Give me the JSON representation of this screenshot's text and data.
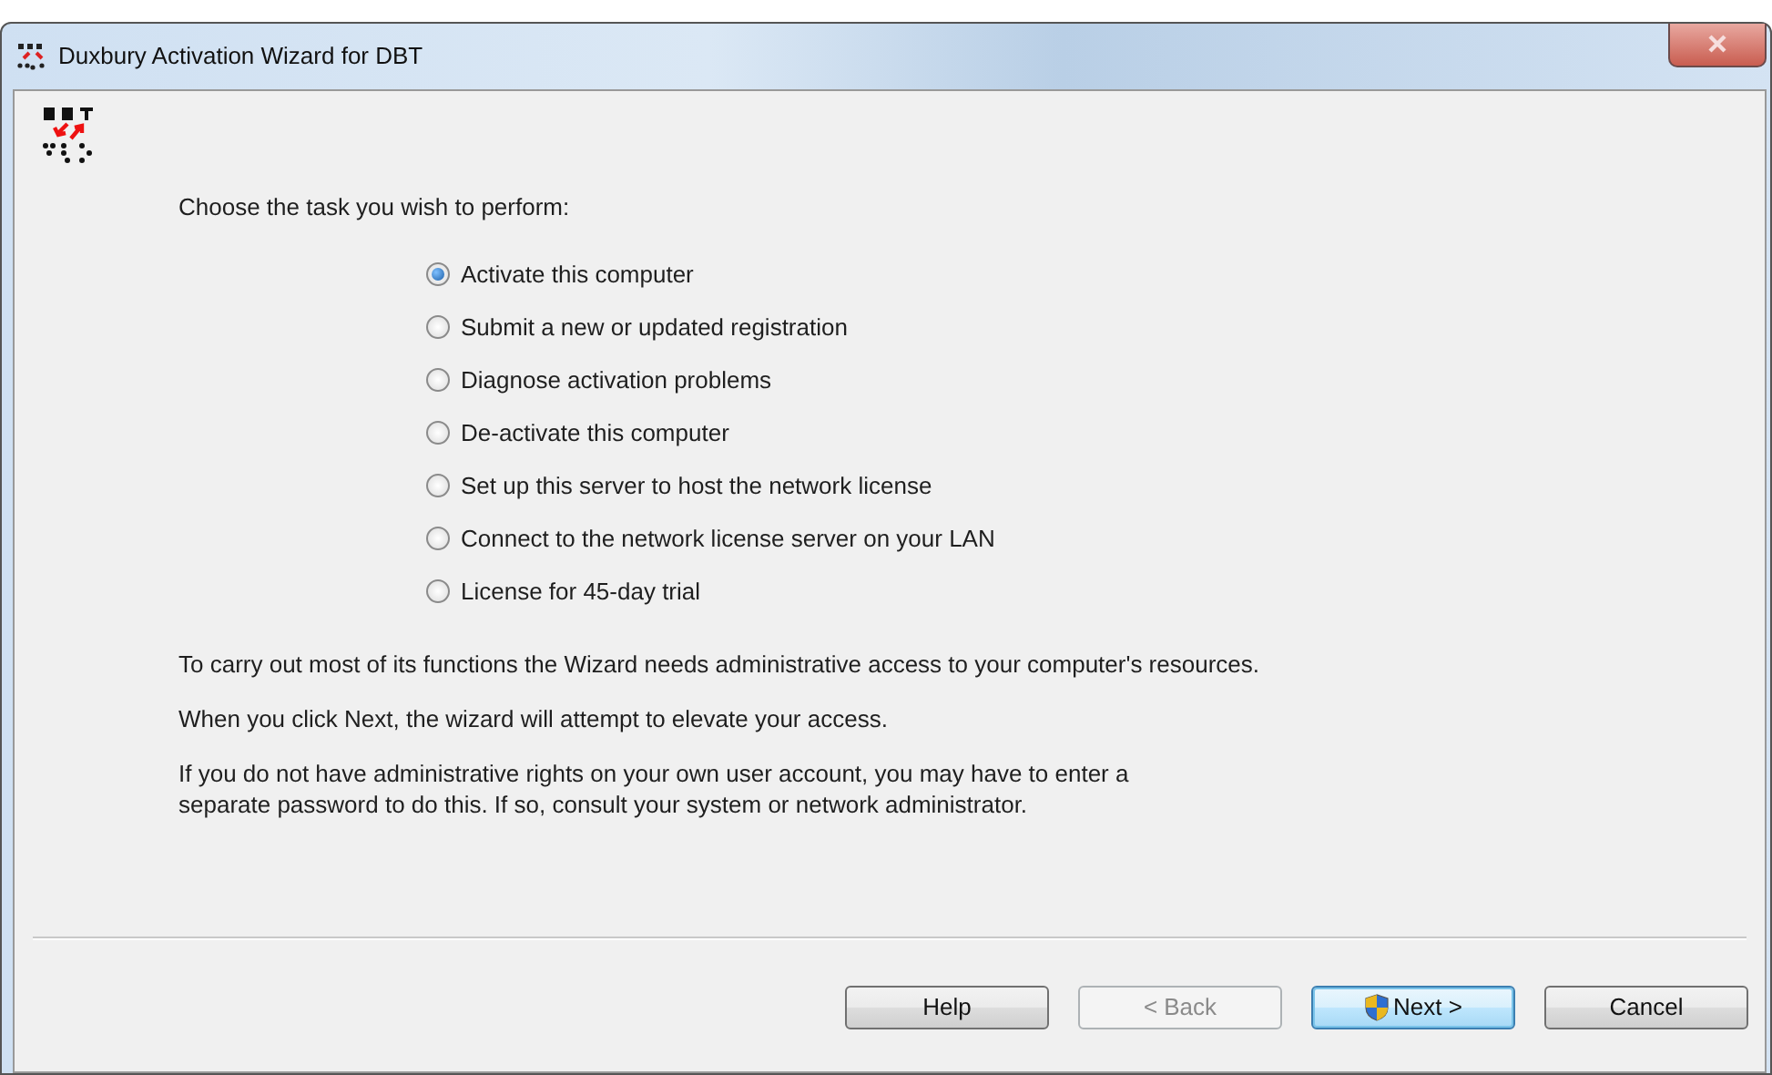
{
  "window": {
    "title": "Duxbury Activation Wizard for DBT"
  },
  "prompt": "Choose the task you wish to perform:",
  "options": [
    {
      "label": "Activate this computer",
      "selected": true
    },
    {
      "label": "Submit a new or updated registration",
      "selected": false
    },
    {
      "label": "Diagnose activation problems",
      "selected": false
    },
    {
      "label": "De-activate this computer",
      "selected": false
    },
    {
      "label": "Set up this server to host the network license",
      "selected": false
    },
    {
      "label": "Connect to the network license server on your LAN",
      "selected": false
    },
    {
      "label": "License for 45-day trial",
      "selected": false
    }
  ],
  "notes": [
    "To carry out most of its functions the Wizard needs administrative access to your computer's resources.",
    "When you click Next, the wizard will attempt to elevate your access.",
    "If you do not have administrative rights on your own user account, you may have to enter a\nseparate password to do this. If so, consult your system or network administrator."
  ],
  "buttons": [
    {
      "label": "Help",
      "kind": "plain",
      "disabled": false
    },
    {
      "label": "< Back",
      "kind": "plain",
      "disabled": true
    },
    {
      "label": "Next >",
      "kind": "shield",
      "disabled": false
    },
    {
      "label": "Cancel",
      "kind": "plain",
      "disabled": false
    }
  ]
}
